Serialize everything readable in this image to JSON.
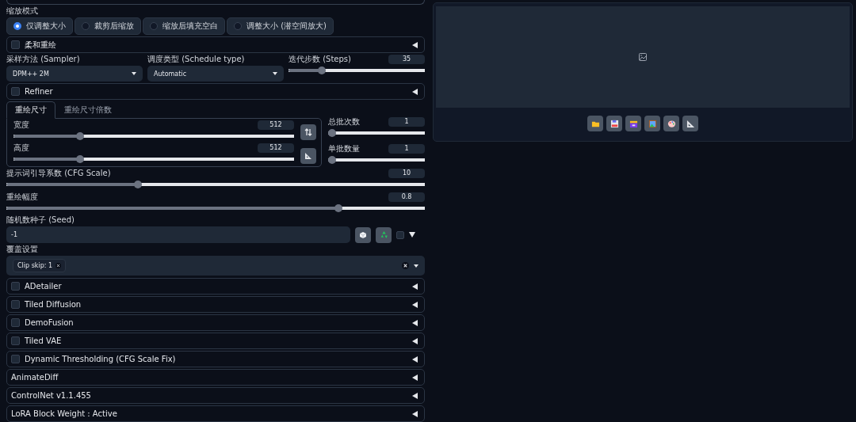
{
  "resize_mode": {
    "label": "缩放模式",
    "options": [
      {
        "label": "仅调整大小",
        "selected": true
      },
      {
        "label": "裁剪后缩放",
        "selected": false
      },
      {
        "label": "缩放后填充空白",
        "selected": false
      },
      {
        "label": "调整大小 (潜空间放大)",
        "selected": false
      }
    ]
  },
  "soft_inpainting": {
    "label": "柔和重绘",
    "checked": false
  },
  "sampler": {
    "label": "采样方法 (Sampler)",
    "value": "DPM++ 2M"
  },
  "schedule": {
    "label": "调度类型 (Schedule type)",
    "value": "Automatic"
  },
  "steps": {
    "label": "迭代步数 (Steps)",
    "value": "35",
    "level": 0.23
  },
  "refiner": {
    "label": "Refiner",
    "checked": false
  },
  "size_tabs": [
    {
      "label": "重绘尺寸",
      "selected": true
    },
    {
      "label": "重绘尺寸倍数",
      "selected": false
    }
  ],
  "width": {
    "label": "宽度",
    "value": "512",
    "level": 0.23
  },
  "height": {
    "label": "高度",
    "value": "512",
    "level": 0.23
  },
  "batch_count": {
    "label": "总批次数",
    "value": "1",
    "level": 0
  },
  "batch_size": {
    "label": "单批数量",
    "value": "1",
    "level": 0
  },
  "cfg_scale": {
    "label": "提示词引导系数 (CFG Scale)",
    "value": "10",
    "level": 0.31
  },
  "denoising": {
    "label": "重绘幅度",
    "value": "0.8",
    "level": 0.8
  },
  "seed": {
    "label": "随机数种子 (Seed)",
    "value": "-1",
    "extra_checked": false
  },
  "override": {
    "label": "覆盖设置",
    "tags": [
      "Clip skip: 1"
    ]
  },
  "scripts": [
    {
      "label": "ADetailer",
      "kind": "checkbox",
      "checked": false
    },
    {
      "label": "Tiled Diffusion",
      "kind": "checkbox",
      "checked": false
    },
    {
      "label": "DemoFusion",
      "kind": "checkbox",
      "checked": false
    },
    {
      "label": "Tiled VAE",
      "kind": "checkbox",
      "checked": false
    },
    {
      "label": "Dynamic Thresholding (CFG Scale Fix)",
      "kind": "checkbox",
      "checked": false
    },
    {
      "label": "AnimateDiff",
      "kind": "plain"
    },
    {
      "label": "ControlNet v1.1.455",
      "kind": "plain"
    },
    {
      "label": "LoRA Block Weight : Active",
      "kind": "plain"
    }
  ]
}
